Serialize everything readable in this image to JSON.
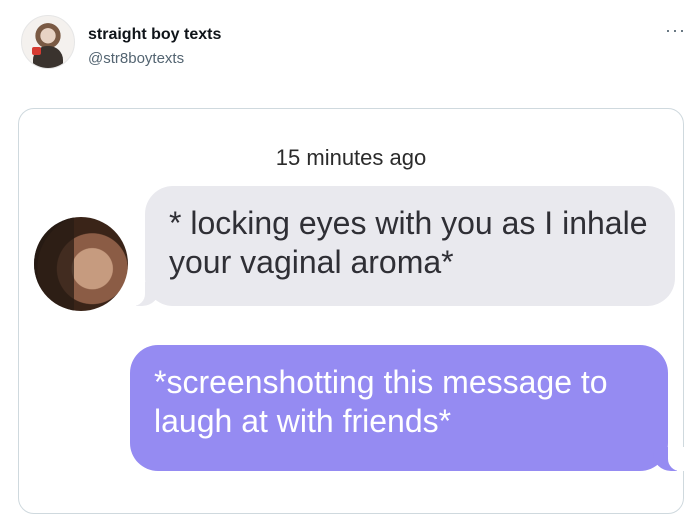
{
  "tweet": {
    "author_name": "straight boy texts",
    "author_handle": "@str8boytexts",
    "more_icon": "more-options-icon"
  },
  "screenshot": {
    "timestamp": "15 minutes ago",
    "messages": [
      {
        "direction": "incoming",
        "text": "* locking eyes with you as I inhale your vaginal aroma*"
      },
      {
        "direction": "outgoing",
        "text": "*screenshotting this message to laugh at with friends*"
      }
    ],
    "colors": {
      "incoming_bubble": "#e9e9ee",
      "outgoing_bubble": "#958bf2"
    }
  }
}
